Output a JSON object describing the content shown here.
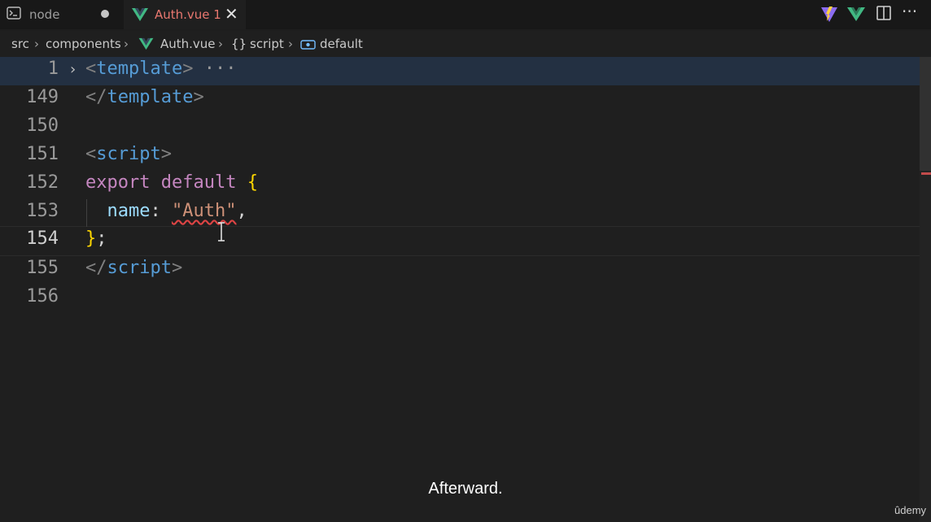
{
  "tabs": [
    {
      "label": "node",
      "icon": "terminal-icon",
      "dirty": true
    },
    {
      "label": "Auth.vue 1",
      "icon": "vue-icon",
      "active": true
    }
  ],
  "toolbar": {
    "icons": [
      "vite-icon",
      "vue-devtools-icon",
      "split-editor-icon",
      "more-actions-icon"
    ]
  },
  "breadcrumb": {
    "items": [
      "src",
      "components",
      "Auth.vue",
      "script",
      "default"
    ],
    "icons": {
      "script": "braces-icon",
      "default": "symbol-icon"
    }
  },
  "editor": {
    "lines": [
      {
        "num": "1",
        "folded": true
      },
      {
        "num": "149"
      },
      {
        "num": "150"
      },
      {
        "num": "151"
      },
      {
        "num": "152"
      },
      {
        "num": "153"
      },
      {
        "num": "154",
        "active": true
      },
      {
        "num": "155"
      },
      {
        "num": "156"
      }
    ],
    "tokens": {
      "l1_open": "<",
      "l1_tag": "template",
      "l1_close": ">",
      "l1_ellipsis": "···",
      "l149_open": "</",
      "l149_tag": "template",
      "l149_close": ">",
      "l151_open": "<",
      "l151_tag": "script",
      "l151_close": ">",
      "l152_kw1": "export",
      "l152_kw2": "default",
      "l152_brace": "{",
      "l153_prop": "name",
      "l153_colon": ": ",
      "l153_str": "\"Auth\"",
      "l153_comma": ",",
      "l154_brace": "}",
      "l154_semi": ";",
      "l155_open": "</",
      "l155_tag": "script",
      "l155_close": ">"
    }
  },
  "caption": "Afterward.",
  "brand": "ûdemy",
  "colors": {
    "tag": "#569cd6",
    "keyword": "#c586c0",
    "brace": "#ffd700",
    "property": "#9cdcfe",
    "string": "#ce9178",
    "tab_active_text": "#e8776f",
    "vue_green": "#41b883"
  }
}
